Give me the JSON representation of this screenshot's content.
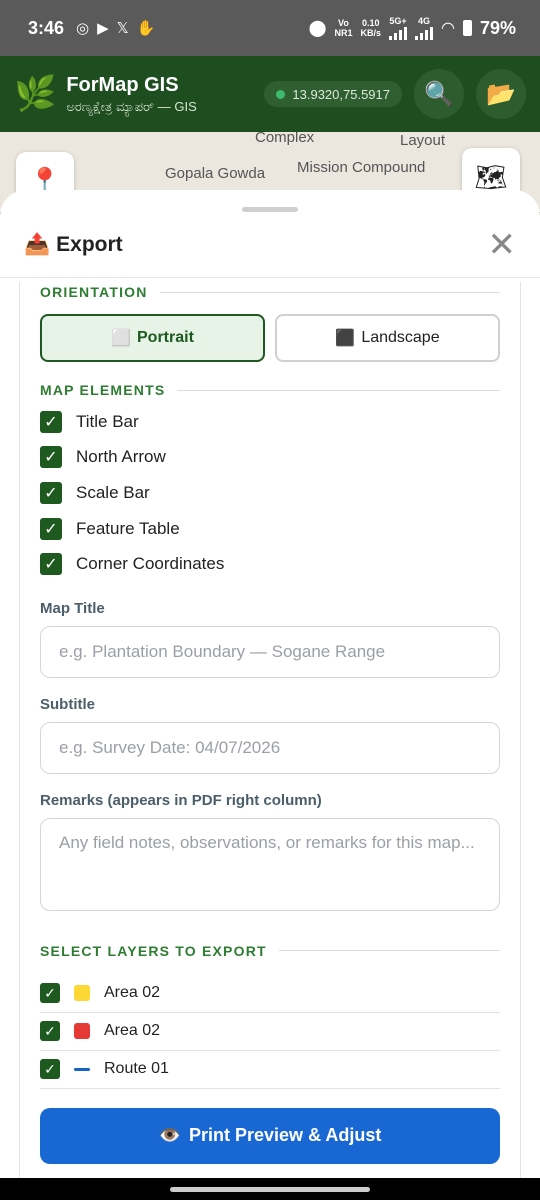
{
  "status": {
    "time": "3:46",
    "network_top": "Vo",
    "network_bottom": "NR1",
    "speed_top": "0.10",
    "speed_bottom": "KB/s",
    "g5": "5G+",
    "g4": "4G",
    "battery": "79%"
  },
  "header": {
    "title": "ForMap GIS",
    "subtitle": "ಅರಣ್ಯಕ್ಷೇತ್ರ ಮ್ಯಾಪರ್ — GIS",
    "coords": "13.9320,75.5917",
    "coord_dot_color": "#3dbb6c"
  },
  "map": {
    "labels": [
      "Complex",
      "Layout",
      "Gopala Gowda",
      "Mission Compound"
    ]
  },
  "sheet": {
    "title": "Export",
    "orientation": {
      "heading": "ORIENTATION",
      "portrait": "Portrait",
      "landscape": "Landscape",
      "selected": "Portrait"
    },
    "elements": {
      "heading": "MAP ELEMENTS",
      "items": [
        {
          "label": "Title Bar",
          "checked": true
        },
        {
          "label": "North Arrow",
          "checked": true
        },
        {
          "label": "Scale Bar",
          "checked": true
        },
        {
          "label": "Feature Table",
          "checked": true
        },
        {
          "label": "Corner Coordinates",
          "checked": true
        }
      ]
    },
    "map_title": {
      "label": "Map Title",
      "placeholder": "e.g. Plantation Boundary — Sogane Range",
      "value": ""
    },
    "subtitle": {
      "label": "Subtitle",
      "placeholder": "e.g. Survey Date: 04/07/2026",
      "value": ""
    },
    "remarks": {
      "label": "Remarks (appears in PDF right column)",
      "placeholder": "Any field notes, observations, or remarks for this map...",
      "value": ""
    },
    "layers": {
      "heading": "SELECT LAYERS TO EXPORT",
      "items": [
        {
          "name": "Area 02",
          "color": "#fdd835",
          "kind": "polygon",
          "checked": true
        },
        {
          "name": "Area 02",
          "color": "#e53935",
          "kind": "polygon",
          "checked": true
        },
        {
          "name": "Route 01",
          "color": "#1565c0",
          "kind": "line",
          "checked": true
        }
      ]
    },
    "preview_button": "Print Preview & Adjust"
  },
  "colors": {
    "primary_green": "#1e5a20",
    "preview_blue": "#1967d2",
    "export_orange": "#fb8c00"
  }
}
